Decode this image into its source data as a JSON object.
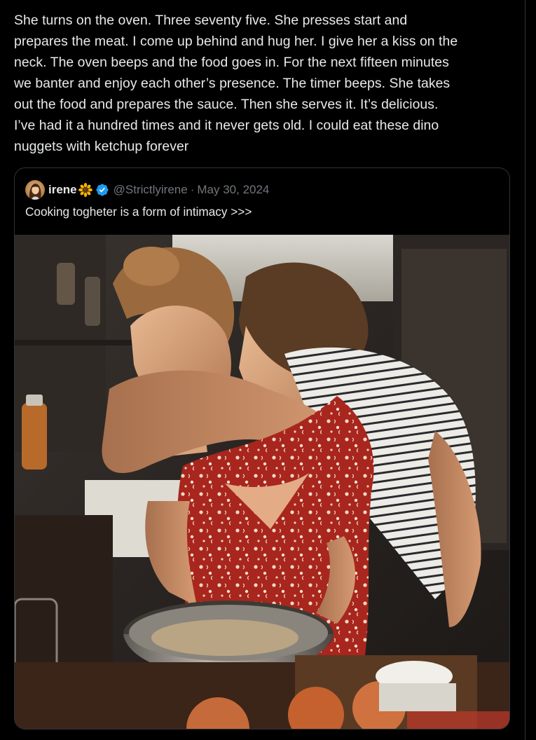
{
  "tweet": {
    "text": "She turns on the oven. Three seventy five. She presses start and\nprepares the meat. I come up behind and hug her. I give her a kiss on the\nneck. The oven beeps and the food goes in. For the next fifteen minutes\nwe banter and enjoy each other’s presence. The timer beeps. She takes\nout the food and prepares the sauce. Then she serves it. It’s delicious.\nI’ve had it a hundred times and it never gets old. I could eat these dino\nnuggets with ketchup forever"
  },
  "quote": {
    "author_name": "irene",
    "author_emoji_icon": "sunflower-icon",
    "verified_icon": "verified-badge-icon",
    "handle": "@Strictlyirene",
    "separator": "·",
    "date": "May 30, 2024",
    "text": "Cooking togheter is a form of intimacy >>>",
    "photo_icon": "couple-cooking-photo"
  },
  "colors": {
    "background": "#000000",
    "text_primary": "#e7e9ea",
    "text_secondary": "#71767b",
    "border": "#2f3336",
    "verified_blue": "#1d9bf0"
  }
}
